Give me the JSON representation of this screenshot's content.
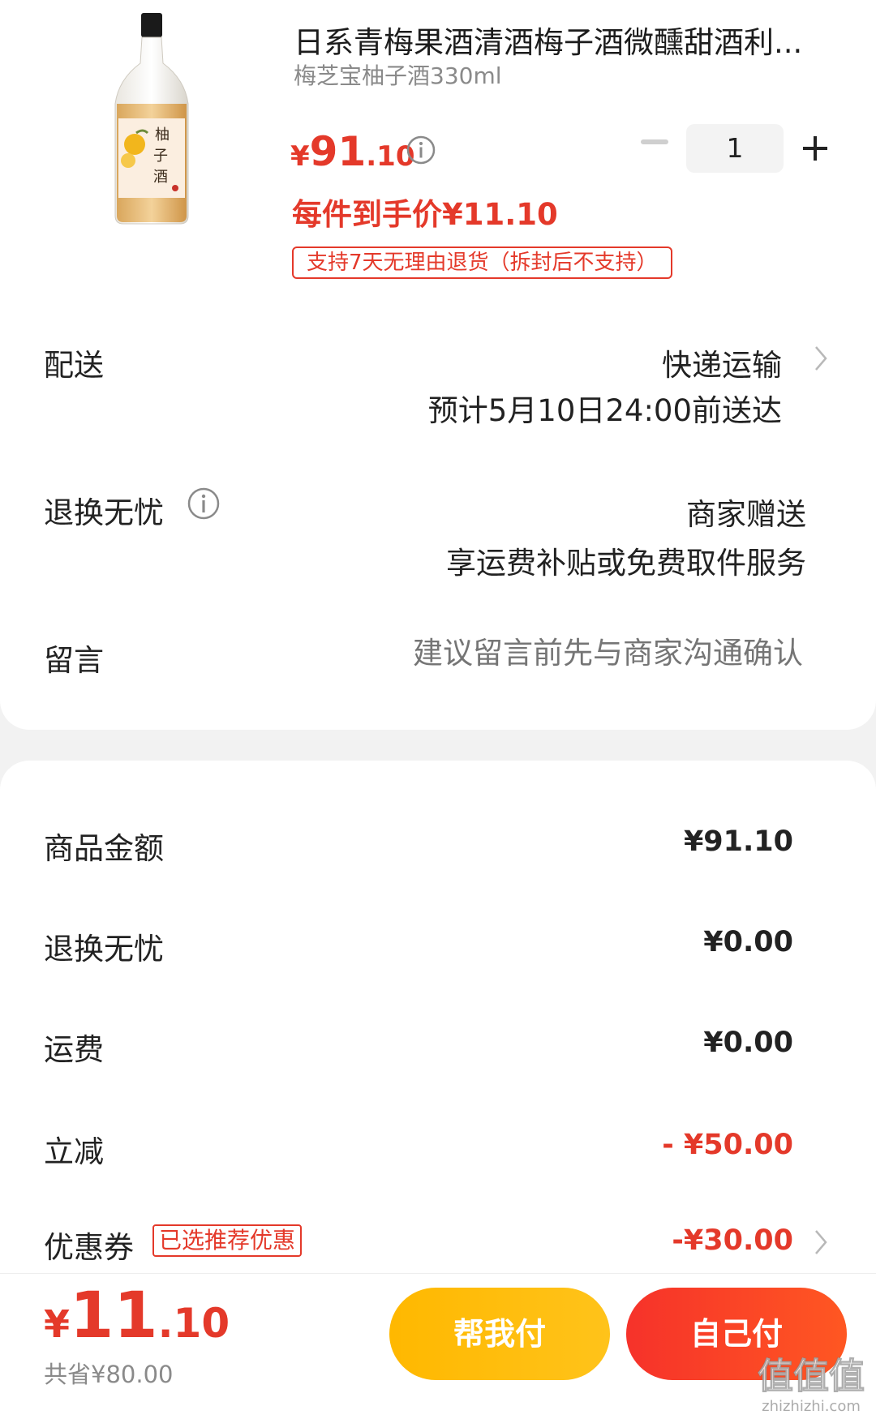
{
  "product": {
    "title": "日系青梅果酒清酒梅子酒微醺甜酒利...",
    "variant": "梅芝宝柚子酒330ml",
    "price": {
      "currency": "¥",
      "integer": "91",
      "decimal": ".10"
    },
    "unit_price": "每件到手价¥11.10",
    "return_tag": "支持7天无理由退货（拆封后不支持）",
    "quantity": "1",
    "bottle_label": "柚子酒"
  },
  "delivery": {
    "label": "配送",
    "method": "快递运输",
    "eta": "预计5月10日24:00前送达"
  },
  "worry_free": {
    "label": "退换无忧",
    "line1": "商家赠送",
    "line2": "享运费补贴或免费取件服务"
  },
  "message": {
    "label": "留言",
    "placeholder": "建议留言前先与商家沟通确认"
  },
  "summary": {
    "goods_label": "商品金额",
    "goods_value": "¥91.10",
    "worry_label": "退换无忧",
    "worry_value": "¥0.00",
    "shipping_label": "运费",
    "shipping_value": "¥0.00",
    "discount_label": "立减",
    "discount_value": "- ¥50.00",
    "coupon_label": "优惠券",
    "coupon_tag": "已选推荐优惠",
    "coupon_value": "-¥30.00"
  },
  "bottom": {
    "total": {
      "currency": "¥",
      "integer": "11",
      "decimal": ".10"
    },
    "saved": "共省¥80.00",
    "help_pay": "帮我付",
    "self_pay": "自己付",
    "watermark": "值值值",
    "watermark_url": "zhizhizhi.com"
  },
  "colors": {
    "accent_red": "#e4392a",
    "help_button": "#ffb800",
    "self_button": "#f6322a"
  }
}
